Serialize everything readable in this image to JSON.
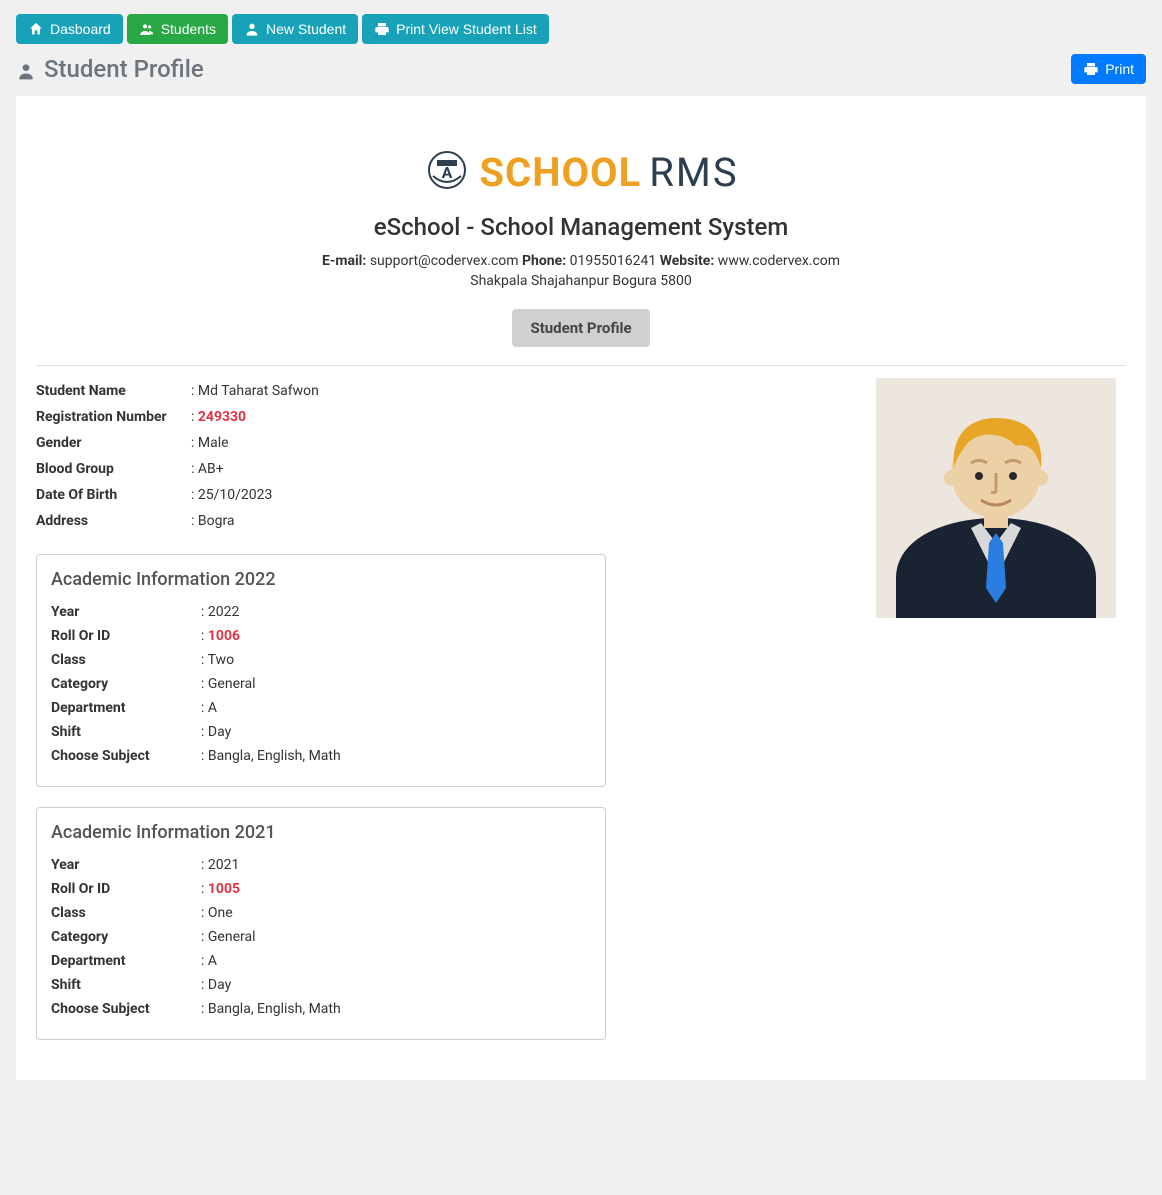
{
  "toolbar": {
    "dashboard": "Dasboard",
    "students": "Students",
    "newStudent": "New Student",
    "printList": "Print View Student List"
  },
  "pageTitle": "Student Profile",
  "printBtn": "Print",
  "school": {
    "logoA": "SCHOOL",
    "logoB": "RMS",
    "name": "eSchool - School Management System",
    "emailLabel": "E-mail:",
    "email": "support@codervex.com",
    "phoneLabel": "Phone:",
    "phone": "01955016241",
    "websiteLabel": "Website:",
    "website": "www.codervex.com",
    "address": "Shakpala Shajahanpur Bogura 5800",
    "badge": "Student Profile"
  },
  "labels": {
    "studentName": "Student Name",
    "regNo": "Registration Number",
    "gender": "Gender",
    "blood": "Blood Group",
    "dob": "Date Of Birth",
    "address": "Address",
    "year": "Year",
    "roll": "Roll Or ID",
    "class": "Class",
    "category": "Category",
    "department": "Department",
    "shift": "Shift",
    "subject": "Choose Subject"
  },
  "student": {
    "name": "Md Taharat Safwon",
    "regNo": "249330",
    "gender": "Male",
    "blood": "AB+",
    "dob": "25/10/2023",
    "address": "Bogra"
  },
  "academics": [
    {
      "title": "Academic Information 2022",
      "year": "2022",
      "roll": "1006",
      "class": "Two",
      "category": "General",
      "department": "A",
      "shift": "Day",
      "subject": "Bangla, English, Math"
    },
    {
      "title": "Academic Information 2021",
      "year": "2021",
      "roll": "1005",
      "class": "One",
      "category": "General",
      "department": "A",
      "shift": "Day",
      "subject": "Bangla, English, Math"
    }
  ]
}
